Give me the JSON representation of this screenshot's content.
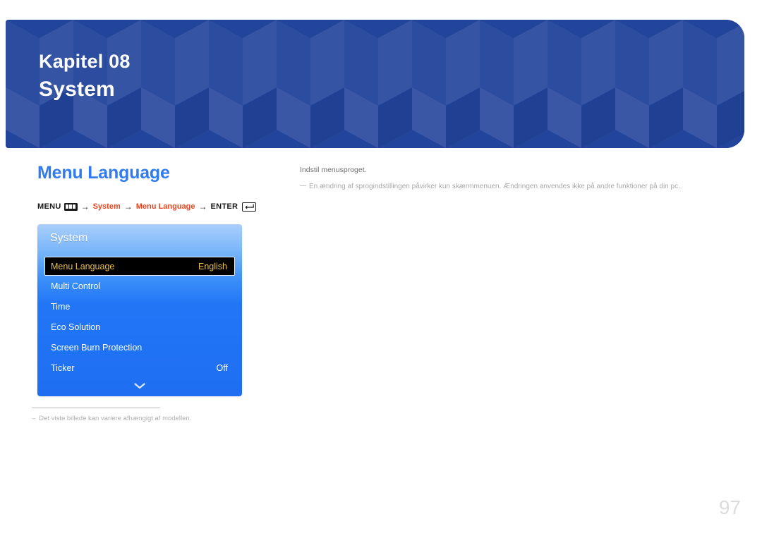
{
  "banner": {
    "chapter_label": "Kapitel 08",
    "chapter_title": "System",
    "background_color": "#22449b"
  },
  "section": {
    "heading": "Menu Language",
    "heading_color": "#2f7bef"
  },
  "breadcrumb": {
    "menu_label": "MENU",
    "menu_icon": "menu-bars-icon",
    "arrow": "→",
    "step_system": "System",
    "step_menu_language": "Menu Language",
    "enter_label": "ENTER",
    "enter_icon": "enter-return-icon",
    "link_color": "#e8441f"
  },
  "osd": {
    "title": "System",
    "rows": [
      {
        "label": "Menu Language",
        "value": "English",
        "selected": true
      },
      {
        "label": "Multi Control",
        "value": "",
        "selected": false
      },
      {
        "label": "Time",
        "value": "",
        "selected": false
      },
      {
        "label": "Eco Solution",
        "value": "",
        "selected": false
      },
      {
        "label": "Screen Burn Protection",
        "value": "",
        "selected": false
      },
      {
        "label": "Ticker",
        "value": "Off",
        "selected": false
      }
    ],
    "scroll_icon": "chevron-down-icon",
    "highlight_text_color": "#e9c04b",
    "panel_color": "#1f7ff5"
  },
  "footnote": {
    "dash": "–",
    "text": "Det viste billede kan variere afhængigt af modellen."
  },
  "description": {
    "main": "Indstil menusproget.",
    "note": "En ændring af sprogindstillingen påvirker kun skærmmenuen. Ændringen anvendes ikke på andre funktioner på din pc."
  },
  "footer": {
    "page_number": "97"
  }
}
